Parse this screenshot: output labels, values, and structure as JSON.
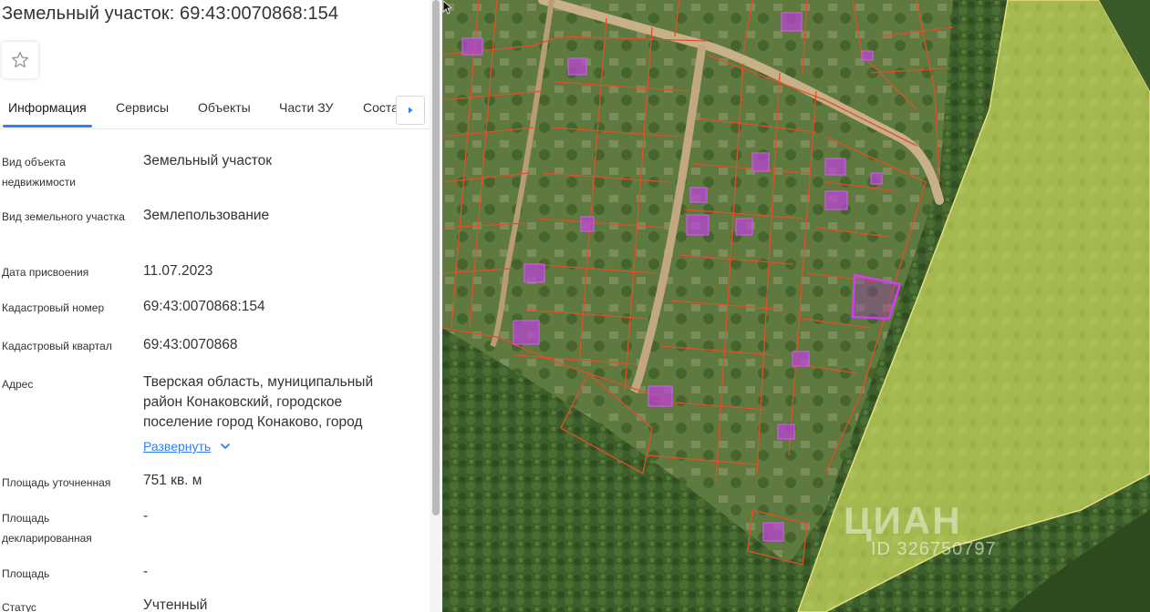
{
  "title": "Земельный участок: 69:43:0070868:154",
  "tabs": [
    "Информация",
    "Сервисы",
    "Объекты",
    "Части ЗУ",
    "Соста"
  ],
  "rows": [
    {
      "label": "Вид объекта недвижимости",
      "value": "Земельный участок"
    },
    {
      "label": "Вид земельного участка",
      "value": "Землепользование"
    },
    {
      "label": "Дата присвоения",
      "value": "11.07.2023"
    },
    {
      "label": "Кадастровый номер",
      "value": "69:43:0070868:154"
    },
    {
      "label": "Кадастровый квартал",
      "value": "69:43:0070868"
    },
    {
      "label": "Адрес",
      "value": "Тверская область, муниципальный район Конаковский, городское поселение город Конаково, город"
    },
    {
      "label": "Площадь уточненная",
      "value": "751 кв. м"
    },
    {
      "label": "Площадь декларированная",
      "value": "-"
    },
    {
      "label": "Площадь",
      "value": "-"
    },
    {
      "label": "Статус",
      "value": "Учтенный"
    }
  ],
  "expand_label": "Развернуть",
  "watermark": {
    "logo": "ЦИАН",
    "id_text": "ID 326750797"
  },
  "colors": {
    "accent": "#2f80ed",
    "parcel_border": "#e0502a",
    "highlight": "#c040e0",
    "zone_fill": "#c8d84a"
  }
}
